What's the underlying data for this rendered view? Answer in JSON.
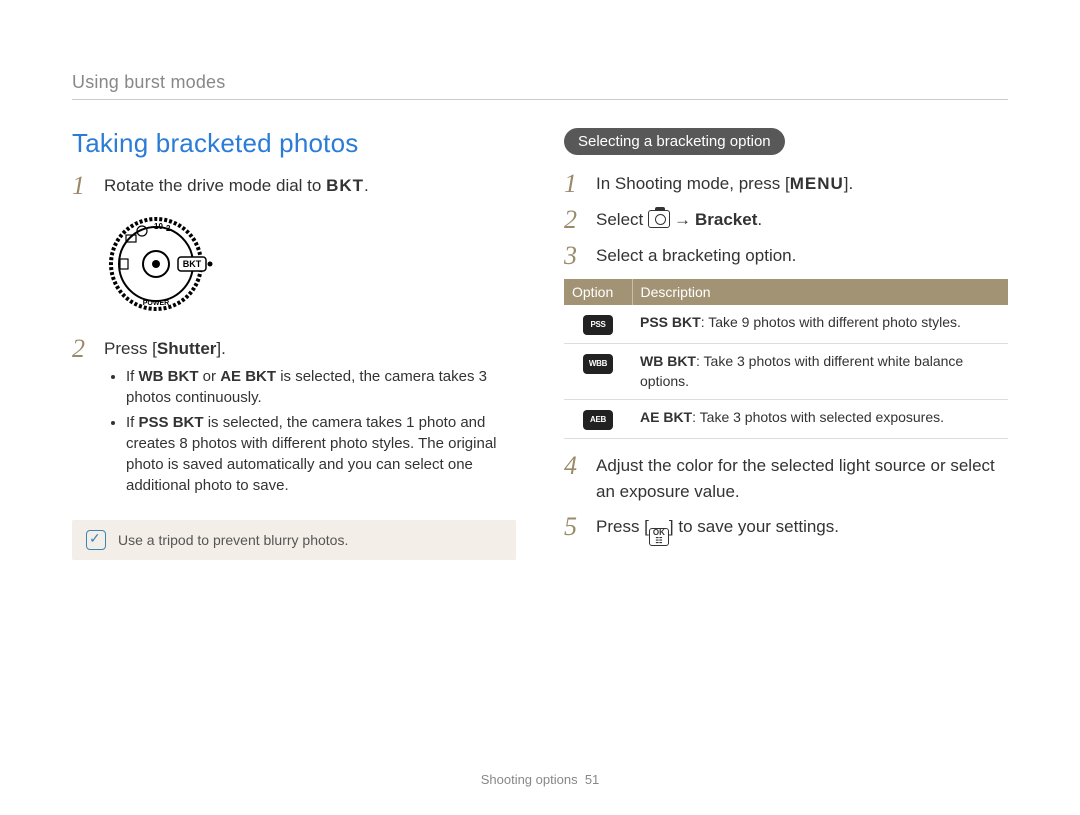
{
  "section_header": "Using burst modes",
  "left": {
    "title": "Taking bracketed photos",
    "step1_pre": "Rotate the drive mode dial to ",
    "step1_bkt": "BKT",
    "step1_post": ".",
    "step2_pre": "Press [",
    "step2_shutter": "Shutter",
    "step2_post": "].",
    "b1_pre": "If ",
    "b1_wb": "WB BKT",
    "b1_mid": " or ",
    "b1_ae": "AE BKT",
    "b1_post": " is selected, the camera takes 3 photos continuously.",
    "b2_pre": "If ",
    "b2_pss": "PSS BKT",
    "b2_post": " is selected, the camera takes 1 photo and creates 8 photos with different photo styles. The original photo is saved automatically and you can select one additional photo to save.",
    "tip": "Use a tripod to prevent blurry photos."
  },
  "right": {
    "pill": "Selecting a bracketing option",
    "s1_pre": "In Shooting mode, press [",
    "s1_menu": "MENU",
    "s1_post": "].",
    "s2_pre": "Select ",
    "s2_bracket": "Bracket",
    "s2_post": ".",
    "s3": "Select a bracketing option.",
    "th_option": "Option",
    "th_desc": "Description",
    "row1_icon": "PSS",
    "row1_b": "PSS BKT",
    "row1_t": ": Take 9 photos with different photo styles.",
    "row2_icon": "WBB",
    "row2_b": "WB BKT",
    "row2_t": ": Take 3 photos with different white balance options.",
    "row3_icon": "AEB",
    "row3_b": "AE BKT",
    "row3_t": ": Take 3 photos with selected exposures.",
    "s4": "Adjust the color for the selected light source or select an exposure value.",
    "s5_pre": "Press [",
    "s5_post": "] to save your settings.",
    "ok_top": "OK",
    "ok_bot": "☷"
  },
  "footer_label": "Shooting options",
  "footer_page": "51"
}
